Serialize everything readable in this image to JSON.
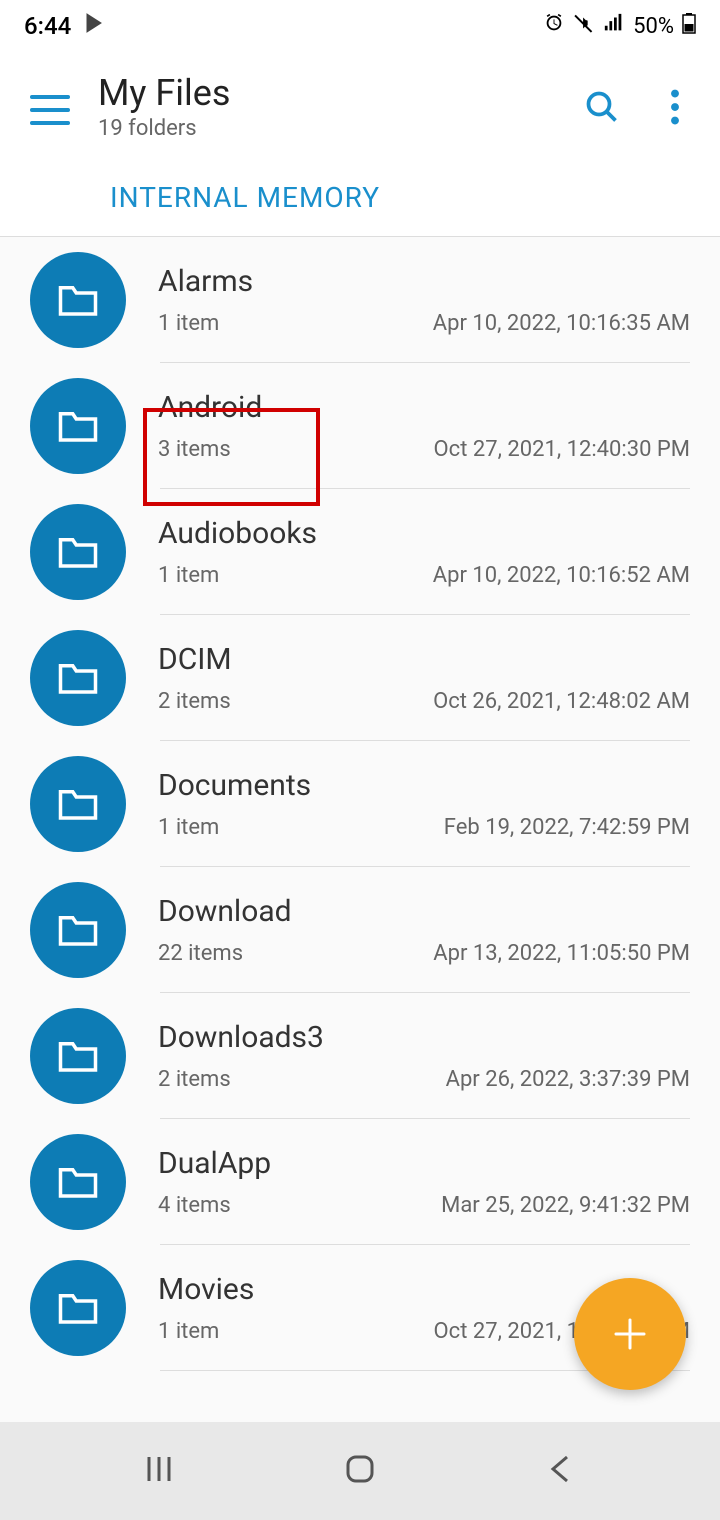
{
  "statusBar": {
    "time": "6:44",
    "battery": "50%"
  },
  "header": {
    "title": "My Files",
    "subtitle": "19 folders"
  },
  "tab": {
    "label": "INTERNAL MEMORY"
  },
  "folders": [
    {
      "name": "Alarms",
      "count": "1 item",
      "date": "Apr 10, 2022, 10:16:35 AM"
    },
    {
      "name": "Android",
      "count": "3 items",
      "date": "Oct 27, 2021, 12:40:30 PM"
    },
    {
      "name": "Audiobooks",
      "count": "1 item",
      "date": "Apr 10, 2022, 10:16:52 AM"
    },
    {
      "name": "DCIM",
      "count": "2 items",
      "date": "Oct 26, 2021, 12:48:02 AM"
    },
    {
      "name": "Documents",
      "count": "1 item",
      "date": "Feb 19, 2022, 7:42:59 PM"
    },
    {
      "name": "Download",
      "count": "22 items",
      "date": "Apr 13, 2022, 11:05:50 PM"
    },
    {
      "name": "Downloads3",
      "count": "2 items",
      "date": "Apr 26, 2022, 3:37:39 PM"
    },
    {
      "name": "DualApp",
      "count": "4 items",
      "date": "Mar 25, 2022, 9:41:32 PM"
    },
    {
      "name": "Movies",
      "count": "1 item",
      "date": "Oct 27, 2021, 12:40:37 PM"
    }
  ],
  "colors": {
    "accent": "#1a8fcc",
    "folderBg": "#0d7cb5",
    "fab": "#f5a623",
    "highlight": "#d00000"
  }
}
